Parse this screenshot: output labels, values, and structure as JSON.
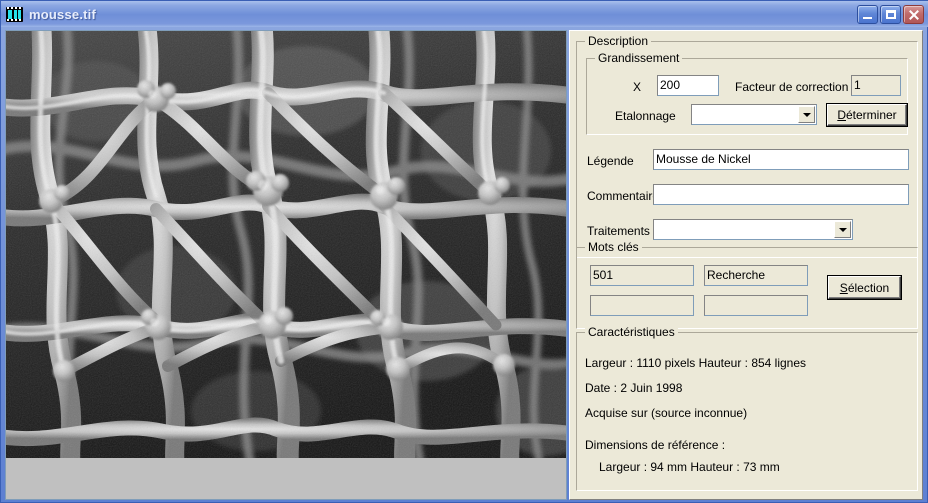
{
  "window": {
    "title": "mousse.tif",
    "icon": "film-strip-icon",
    "buttons": {
      "minimize": "minimize-button",
      "maximize": "maximize-button",
      "close": "close-button"
    }
  },
  "image_pane": {
    "name": "sem-micrograph",
    "alt": "Scanning electron micrograph of nickel foam: bright interconnected ligaments forming an open cellular network over a dark background"
  },
  "description": {
    "group_label": "Description",
    "magnification": {
      "group_label": "Grandissement",
      "x_label": "X",
      "x_value": "200",
      "correction_label": "Facteur de correction",
      "correction_value": "1",
      "calibration_label": "Etalonnage",
      "calibration_value": "",
      "determine_button": "Déterminer",
      "determine_accel": "D"
    },
    "caption_label": "Légende",
    "caption_value": "Mousse de Nickel",
    "comment_label": "Commentaire",
    "comment_value": "",
    "treatments_label": "Traitements",
    "treatments_value": ""
  },
  "keywords": {
    "group_label": "Mots clés",
    "field1": "501",
    "field2": "Recherche",
    "field3": "",
    "field4": "",
    "select_button": "Sélection",
    "select_accel": "S"
  },
  "characteristics": {
    "group_label": "Caractéristiques",
    "size_line": "Largeur :   1110   pixels   Hauteur :    854   lignes",
    "date_line": "Date :     2 Juin 1998",
    "source_line": "Acquise sur  (source inconnue)",
    "ref_dims_label": "Dimensions de référence :",
    "ref_dims_line": "Largeur :      94  mm     Hauteur :     73  mm"
  },
  "colors": {
    "title_bar": "#6f8fd8",
    "panel_face": "#ece9d8",
    "field_bg": "#ffffff",
    "close_button": "#b15757",
    "image_backdrop": "#c0c0c0"
  }
}
